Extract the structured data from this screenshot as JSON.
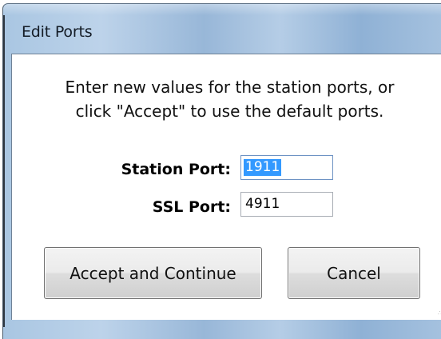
{
  "window": {
    "title": "Edit Ports"
  },
  "instructions": {
    "line1": "Enter new values for the station ports, or",
    "line2": "click \"Accept\" to use the default ports."
  },
  "fields": {
    "station_port": {
      "label": "Station Port:",
      "value": "1911",
      "selected": true
    },
    "ssl_port": {
      "label": "SSL Port:",
      "value": "4911",
      "selected": false
    }
  },
  "buttons": {
    "accept": "Accept and Continue",
    "cancel": "Cancel"
  },
  "colors": {
    "title_bar": "#a9c6e2",
    "selection": "#3399ff",
    "focus_border": "#6e93c4"
  }
}
